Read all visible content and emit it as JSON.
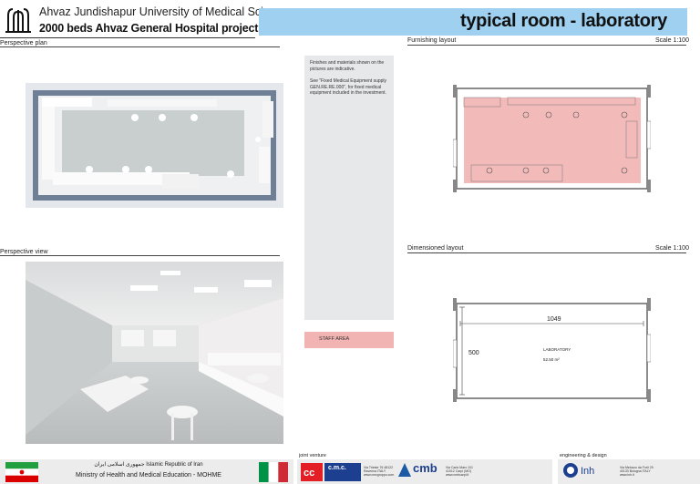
{
  "header": {
    "university": "Ahvaz Jundishapur University of Medical Sciences",
    "project": "2000 beds Ahvaz General Hospital project",
    "title": "typical room - laboratory"
  },
  "sections": {
    "perspective_plan": "Perspective plan",
    "furnishing_layout": "Furnishing layout",
    "furnishing_scale": "Scale 1:100",
    "perspective_view": "Perspective view",
    "dimensioned_layout": "Dimensioned layout",
    "dimensioned_scale": "Scale 1:100"
  },
  "notes": {
    "note1": "Finishes and materials shown on the pictures are indicative.",
    "note2": "See \"Fixed Medical Equipment supply GEN.RE.RE.000\", for fixed medical equipment included in the investment."
  },
  "legend": {
    "staff_area": "STAFF AREA",
    "staff_color": "#f2b3b3"
  },
  "dimensioned": {
    "width": "1049",
    "depth": "500",
    "room_name": "LABORATORY",
    "room_area": "52.50 m²"
  },
  "footer": {
    "ministry_fa": "جمهوری اسلامی ایران Islamic Republic of Iran",
    "ministry_en": "Ministry of Health and Medical Education - MOHME",
    "joint_venture": "joint venture",
    "engineering": "engineering & design",
    "cmc": "c.m.c.",
    "cmb": "cmb",
    "inh": "Inh",
    "cmc_addr": "Via Trieste 76 48122 Ravenna ITALY www.cmcgruppo.com",
    "cmb_addr": "Via Carlo Marx 101 41012 Carpi (MO) www.cmbcarpi.it",
    "inh_addr": "Via Melozzo da Forlì 29 40133 Bologna ITALY www.inh.it"
  },
  "colors": {
    "title_bar": "#9fd0ef",
    "staff_area": "#f2b3b3",
    "notes_bg": "#e7e8e9"
  }
}
